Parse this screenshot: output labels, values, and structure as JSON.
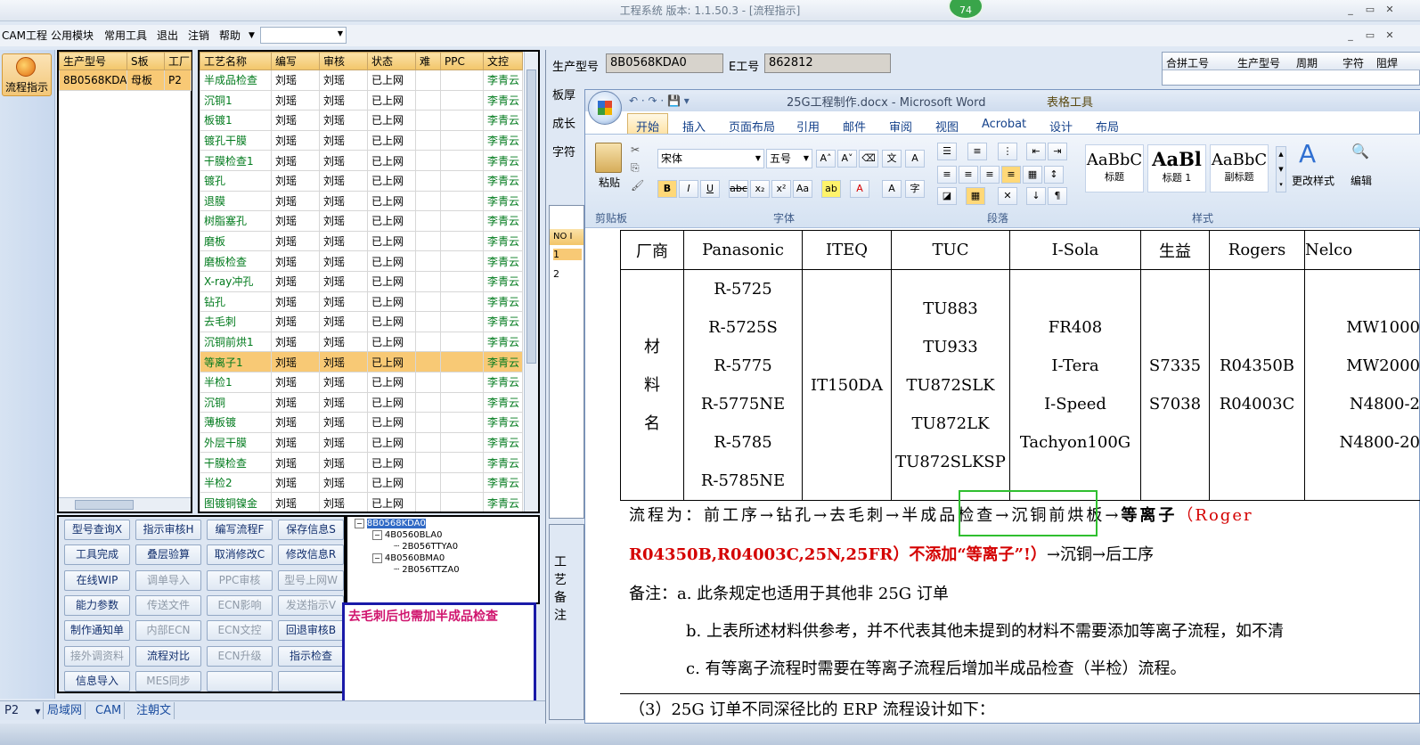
{
  "app": {
    "title": "工程系统  版本: 1.1.50.3 - [流程指示]",
    "badge": "74"
  },
  "menu": {
    "items": [
      "CAM工程",
      "公用模块",
      "常用工具",
      "退出",
      "注销",
      "帮助"
    ]
  },
  "nav": {
    "button": "流程指示"
  },
  "table_a": {
    "headers": [
      "生产型号",
      "S板",
      "工厂"
    ],
    "rows": [
      [
        "8B0568KDA0",
        "母板",
        "P2"
      ]
    ]
  },
  "table_b": {
    "headers": [
      "工艺名称",
      "编写",
      "审核",
      "状态",
      "难",
      "PPC",
      "文控"
    ],
    "rows": [
      [
        "半成品检查",
        "刘瑶",
        "刘瑶",
        "已上网",
        "",
        "",
        "李青云"
      ],
      [
        "沉铜1",
        "刘瑶",
        "刘瑶",
        "已上网",
        "",
        "",
        "李青云"
      ],
      [
        "板镀1",
        "刘瑶",
        "刘瑶",
        "已上网",
        "",
        "",
        "李青云"
      ],
      [
        "镀孔干膜",
        "刘瑶",
        "刘瑶",
        "已上网",
        "",
        "",
        "李青云"
      ],
      [
        "干膜检查1",
        "刘瑶",
        "刘瑶",
        "已上网",
        "",
        "",
        "李青云"
      ],
      [
        "镀孔",
        "刘瑶",
        "刘瑶",
        "已上网",
        "",
        "",
        "李青云"
      ],
      [
        "退膜",
        "刘瑶",
        "刘瑶",
        "已上网",
        "",
        "",
        "李青云"
      ],
      [
        "树脂塞孔",
        "刘瑶",
        "刘瑶",
        "已上网",
        "",
        "",
        "李青云"
      ],
      [
        "磨板",
        "刘瑶",
        "刘瑶",
        "已上网",
        "",
        "",
        "李青云"
      ],
      [
        "磨板检查",
        "刘瑶",
        "刘瑶",
        "已上网",
        "",
        "",
        "李青云"
      ],
      [
        "X-ray冲孔",
        "刘瑶",
        "刘瑶",
        "已上网",
        "",
        "",
        "李青云"
      ],
      [
        "钻孔",
        "刘瑶",
        "刘瑶",
        "已上网",
        "",
        "",
        "李青云"
      ],
      [
        "去毛刺",
        "刘瑶",
        "刘瑶",
        "已上网",
        "",
        "",
        "李青云"
      ],
      [
        "沉铜前烘1",
        "刘瑶",
        "刘瑶",
        "已上网",
        "",
        "",
        "李青云"
      ],
      [
        "等离子1",
        "刘瑶",
        "刘瑶",
        "已上网",
        "",
        "",
        "李青云"
      ],
      [
        "半检1",
        "刘瑶",
        "刘瑶",
        "已上网",
        "",
        "",
        "李青云"
      ],
      [
        "沉铜",
        "刘瑶",
        "刘瑶",
        "已上网",
        "",
        "",
        "李青云"
      ],
      [
        "薄板镀",
        "刘瑶",
        "刘瑶",
        "已上网",
        "",
        "",
        "李青云"
      ],
      [
        "外层干膜",
        "刘瑶",
        "刘瑶",
        "已上网",
        "",
        "",
        "李青云"
      ],
      [
        "干膜检查",
        "刘瑶",
        "刘瑶",
        "已上网",
        "",
        "",
        "李青云"
      ],
      [
        "半检2",
        "刘瑶",
        "刘瑶",
        "已上网",
        "",
        "",
        "李青云"
      ],
      [
        "图镀铜镍金",
        "刘瑶",
        "刘瑶",
        "已上网",
        "",
        "",
        "李青云"
      ]
    ],
    "selected_index": 14
  },
  "buttons": [
    [
      "型号查询X",
      "指示审核H",
      "编写流程F",
      "保存信息S"
    ],
    [
      "工具完成",
      "叠层验算",
      "取消修改C",
      "修改信息R"
    ],
    [
      "在线WIP",
      "调单导入",
      "PPC审核",
      "型号上网W"
    ],
    [
      "能力参数",
      "传送文件",
      "ECN影响",
      "发送指示V"
    ],
    [
      "制作通知单",
      "内部ECN",
      "ECN文控",
      "回退审核B"
    ],
    [
      "接外调资料",
      "流程对比",
      "ECN升级",
      "指示检查"
    ],
    [
      "信息导入",
      "MES同步",
      "",
      ""
    ]
  ],
  "tree": [
    "8B0568KDA0",
    "4B0560BLA0",
    "2B056TTYA0",
    "4B0560BMA0",
    "2B056TTZA0"
  ],
  "note": "去毛刺后也需加半成品检查",
  "bottom_tabs": [
    "P2",
    "局域网",
    "CAM",
    "注朝文"
  ],
  "right": {
    "model_label": "生产型号",
    "model_value": "8B0568KDA0",
    "eno_label": "E工号",
    "eno_value": "862812",
    "side_labels": [
      "板厚",
      "成长",
      "字符"
    ],
    "top_headers": [
      "合拼工号",
      "生产型号",
      "周期",
      "字符",
      "阻焊"
    ],
    "mini_headers": [
      "NO",
      "I"
    ],
    "mini_rows": [
      "1",
      "2"
    ],
    "vertical_label": "工艺备注"
  },
  "word": {
    "title": "25G工程制作.docx - Microsoft Word",
    "context_tab": "表格工具",
    "tabs": [
      "开始",
      "插入",
      "页面布局",
      "引用",
      "邮件",
      "审阅",
      "视图",
      "Acrobat",
      "设计",
      "布局"
    ],
    "font": "宋体",
    "size": "五号",
    "groups": [
      "剪贴板",
      "字体",
      "段落",
      "样式"
    ],
    "paste": "粘贴",
    "styles": [
      {
        "sample": "AaBbC",
        "name": "标题"
      },
      {
        "sample": "AaBl",
        "name": "标题 1"
      },
      {
        "sample": "AaBbC",
        "name": "副标题"
      }
    ],
    "change_style": "更改样式",
    "edit": "编辑"
  },
  "doc": {
    "vendors": [
      "厂商",
      "Panasonic",
      "ITEQ",
      "TUC",
      "I-Sola",
      "生益",
      "Rogers",
      "Nelco"
    ],
    "row_label": "材料名",
    "materials": [
      [
        "R-5725",
        "R-5725S",
        "R-5775",
        "R-5775NE",
        "R-5785",
        "R-5785NE"
      ],
      [
        "IT150DA"
      ],
      [
        "TU883",
        "TU933",
        "TU872SLK",
        "TU872LK",
        "TU872SLKSP"
      ],
      [
        "FR408",
        "I-Tera",
        "I-Speed",
        "Tachyon100G"
      ],
      [
        "S7335",
        "S7038"
      ],
      [
        "R04350B",
        "R04003C"
      ],
      [
        "MW1000",
        "MW2000",
        "N4800-2",
        "N4800-20"
      ]
    ],
    "flow_a": "流程为：前工序→钻孔→去毛刺→",
    "flow_hl": "半成品检查",
    "flow_b": "→沉铜前烘板→",
    "flow_bold": "等离子",
    "flow_red": "（Roger",
    "flow2_red": "R04350B,R04003C,25N,25FR）不添加“等离子”!）",
    "flow2_rest": "→沉铜→后工序",
    "note_a": "备注：a. 此条规定也适用于其他非 25G 订单",
    "note_b": "b. 上表所述材料供参考，并不代表其他未提到的材料不需要添加等离子流程，如不清",
    "note_c": "c. 有等离子流程时需要在等离子流程后增加半成品检查（半检）流程。",
    "foot": "（3）25G 订单不同深径比的 ERP 流程设计如下："
  },
  "colors": {
    "accent": "#f2c569",
    "green": "#007a1c",
    "highlight_box": "#2fbf2f",
    "note_text": "#d0156e",
    "red": "#d40000"
  }
}
